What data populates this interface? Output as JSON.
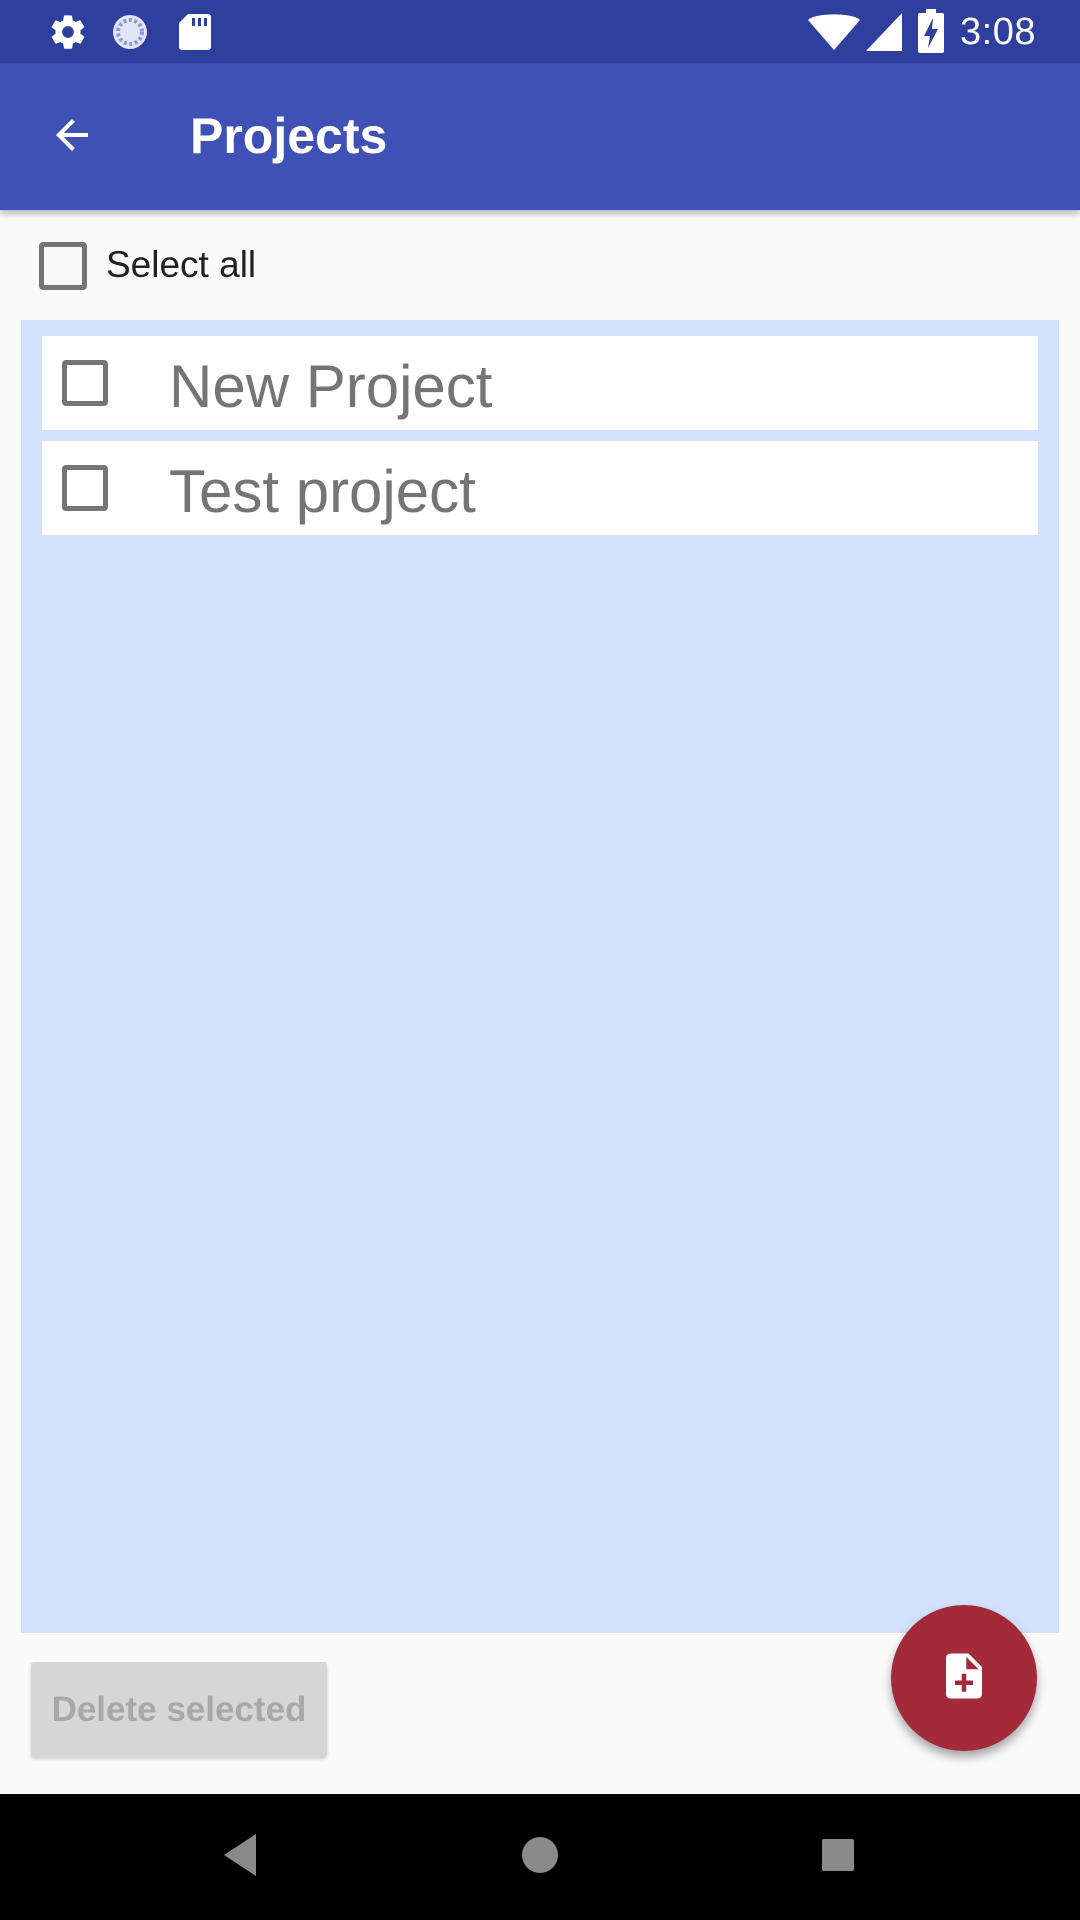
{
  "status_bar": {
    "time": "3:08",
    "left_icons": [
      "settings-icon",
      "sync-icon",
      "sd-card-icon"
    ],
    "right_icons": [
      "wifi-icon",
      "cell-signal-icon",
      "battery-charging-icon"
    ]
  },
  "app_bar": {
    "title": "Projects",
    "back_icon": "arrow-back-icon"
  },
  "select_all": {
    "label": "Select all",
    "checked": false
  },
  "projects": [
    {
      "name": "New Project",
      "checked": false
    },
    {
      "name": "Test project",
      "checked": false
    }
  ],
  "actions": {
    "delete_label": "Delete selected",
    "fab_icon": "note-add-icon"
  },
  "colors": {
    "status_bar": "#2f3f9e",
    "app_bar": "#3f51b5",
    "list_background": "#d2e2fc",
    "fab": "#a32a38"
  },
  "nav_bar": {
    "buttons": [
      "back-triangle-icon",
      "home-circle-icon",
      "recents-square-icon"
    ]
  }
}
